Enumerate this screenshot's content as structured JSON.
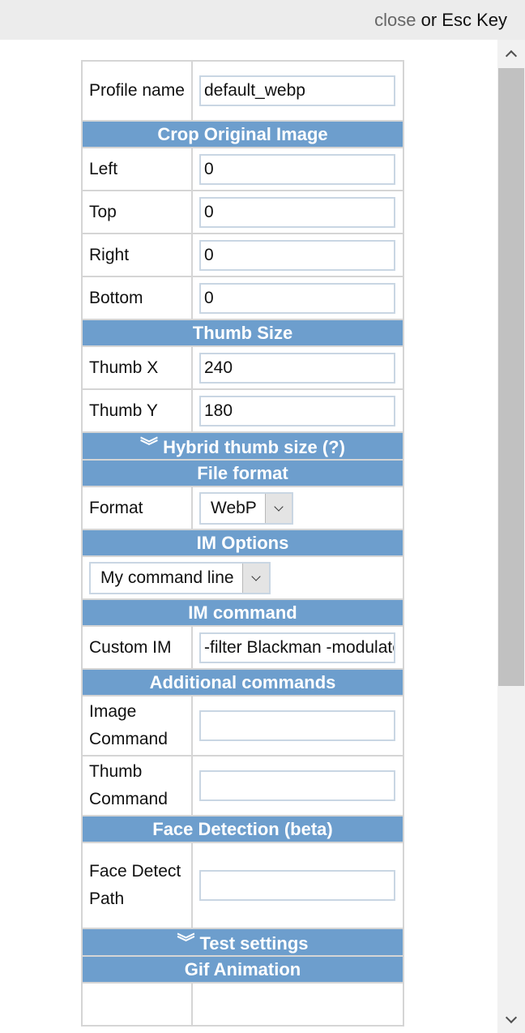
{
  "topbar": {
    "close_label": "close",
    "rest_label": "or Esc Key"
  },
  "profile": {
    "label": "Profile name",
    "value": "default_webp"
  },
  "crop": {
    "header": "Crop Original Image",
    "left": {
      "label": "Left",
      "value": "0"
    },
    "top": {
      "label": "Top",
      "value": "0"
    },
    "right": {
      "label": "Right",
      "value": "0"
    },
    "bottom": {
      "label": "Bottom",
      "value": "0"
    }
  },
  "thumb": {
    "header": "Thumb Size",
    "x": {
      "label": "Thumb X",
      "value": "240"
    },
    "y": {
      "label": "Thumb Y",
      "value": "180"
    }
  },
  "hybrid": {
    "header": "Hybrid thumb size (?)",
    "icon": "double-chevron-down-icon"
  },
  "file_format": {
    "header": "File format",
    "label": "Format",
    "value": "WebP"
  },
  "im_options": {
    "header": "IM Options",
    "value": "My command line"
  },
  "im_command": {
    "header": "IM command",
    "label": "Custom IM",
    "value": "-filter Blackman -modulate"
  },
  "additional": {
    "header": "Additional commands",
    "image_label": "Image Command",
    "image_value": "",
    "thumb_label": "Thumb Command",
    "thumb_value": ""
  },
  "face": {
    "header": "Face Detection (beta)",
    "label": "Face Detect Path",
    "value": ""
  },
  "test_settings": {
    "header": "Test settings",
    "icon": "double-chevron-down-icon"
  },
  "gif": {
    "header": "Gif Animation"
  },
  "colors": {
    "header_bg": "#6d9ecd",
    "border": "#d5d5d5",
    "input_border": "#c9d6e3"
  }
}
